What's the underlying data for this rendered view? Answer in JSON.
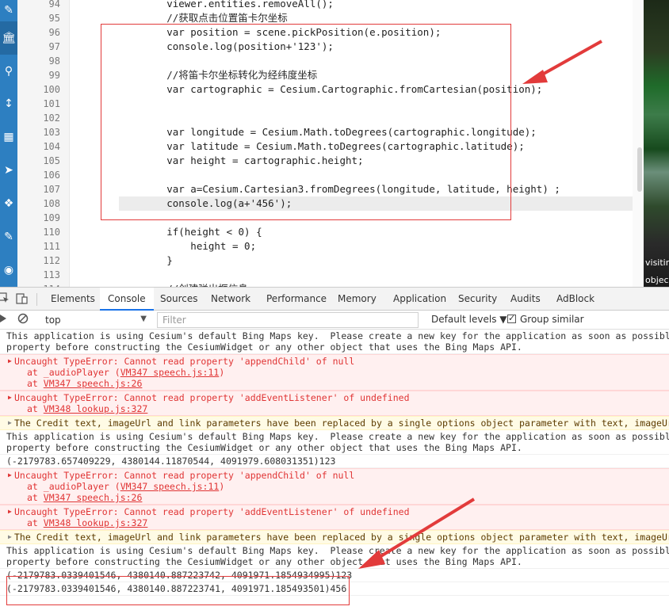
{
  "sidebar": {
    "icons": [
      "pencil-icon",
      "bank-icon",
      "search-icon",
      "arrows-vertical-icon",
      "map-icon",
      "paper-plane-icon",
      "cubes-icon",
      "edit-icon",
      "eye-icon"
    ]
  },
  "editor": {
    "lines": [
      {
        "num": "94",
        "code": "        viewer.entities.removeAll();",
        "type": "code"
      },
      {
        "num": "95",
        "code": "        //获取点击位置笛卡尔坐标",
        "type": "comment"
      },
      {
        "num": "96",
        "code": "        var position = scene.pickPosition(e.position);",
        "type": "code"
      },
      {
        "num": "97",
        "code": "        console.log(position+'123');",
        "type": "code"
      },
      {
        "num": "98",
        "code": "",
        "type": "code"
      },
      {
        "num": "99",
        "code": "        //将笛卡尔坐标转化为经纬度坐标",
        "type": "comment"
      },
      {
        "num": "100",
        "code": "        var cartographic = Cesium.Cartographic.fromCartesian(position);",
        "type": "code"
      },
      {
        "num": "101",
        "code": "",
        "type": "code"
      },
      {
        "num": "102",
        "code": "",
        "type": "code"
      },
      {
        "num": "103",
        "code": "        var longitude = Cesium.Math.toDegrees(cartographic.longitude);",
        "type": "code"
      },
      {
        "num": "104",
        "code": "        var latitude = Cesium.Math.toDegrees(cartographic.latitude);",
        "type": "code"
      },
      {
        "num": "105",
        "code": "        var height = cartographic.height;",
        "type": "code"
      },
      {
        "num": "106",
        "code": "",
        "type": "code"
      },
      {
        "num": "107",
        "code": "        var a=Cesium.Cartesian3.fromDegrees(longitude, latitude, height) ;",
        "type": "code"
      },
      {
        "num": "108",
        "code": "        console.log(a+'456');",
        "type": "cursor"
      },
      {
        "num": "109",
        "code": "",
        "type": "code"
      },
      {
        "num": "110",
        "code": "        if(height < 0) {",
        "type": "code"
      },
      {
        "num": "111",
        "code": "            height = 0;",
        "type": "code"
      },
      {
        "num": "112",
        "code": "        }",
        "type": "code"
      },
      {
        "num": "113",
        "code": "",
        "type": "code"
      },
      {
        "num": "114",
        "code": "        //创建弹出框信息",
        "type": "comment"
      }
    ]
  },
  "preview": {
    "text_1": "visitin",
    "text_2": "objec"
  },
  "devtools": {
    "tabs": [
      "Elements",
      "Console",
      "Sources",
      "Network",
      "Performance",
      "Memory",
      "Application",
      "Security",
      "Audits",
      "AdBlock"
    ],
    "active_tab": "Console"
  },
  "console_toolbar": {
    "context": "top",
    "filter_placeholder": "Filter",
    "levels": "Default levels ▼",
    "group_similar": "Group similar"
  },
  "console_messages": [
    {
      "type": "log",
      "lines": [
        "This application is using Cesium's default Bing Maps key.  Please create a new key for the application as soon as possible and",
        "property before constructing the CesiumWidget or any other object that uses the Bing Maps API."
      ]
    },
    {
      "type": "error",
      "head": "Uncaught TypeError: Cannot read property 'appendChild' of null",
      "stack": [
        [
          "at _audioPlayer (",
          "VM347 speech.js:11",
          ")"
        ],
        [
          "at ",
          "VM347 speech.js:26",
          ""
        ]
      ]
    },
    {
      "type": "error",
      "head": "Uncaught TypeError: Cannot read property 'addEventListener' of undefined",
      "stack": [
        [
          "at ",
          "VM348 lookup.js:327",
          ""
        ]
      ]
    },
    {
      "type": "warn",
      "head": "The Credit text, imageUrl and link parameters have been replaced by a single options object parameter with text, imageUrl and"
    },
    {
      "type": "log",
      "lines": [
        "This application is using Cesium's default Bing Maps key.  Please create a new key for the application as soon as possible and",
        "property before constructing the CesiumWidget or any other object that uses the Bing Maps API."
      ]
    },
    {
      "type": "log",
      "lines": [
        "(-2179783.657409229, 4380144.11870544, 4091979.608031351)123"
      ]
    },
    {
      "type": "error",
      "head": "Uncaught TypeError: Cannot read property 'appendChild' of null",
      "stack": [
        [
          "at _audioPlayer (",
          "VM347 speech.js:11",
          ")"
        ],
        [
          "at ",
          "VM347 speech.js:26",
          ""
        ]
      ]
    },
    {
      "type": "error",
      "head": "Uncaught TypeError: Cannot read property 'addEventListener' of undefined",
      "stack": [
        [
          "at ",
          "VM348 lookup.js:327",
          ""
        ]
      ]
    },
    {
      "type": "warn",
      "head": "The Credit text, imageUrl and link parameters have been replaced by a single options object parameter with text, imageUrl and"
    },
    {
      "type": "log",
      "lines": [
        "This application is using Cesium's default Bing Maps key.  Please create a new key for the application as soon as possible and",
        "property before constructing the CesiumWidget or any other object that uses the Bing Maps API."
      ]
    },
    {
      "type": "log",
      "lines": [
        "(-2179783.0339401546, 4380140.887223742, 4091971.1854934995)123"
      ]
    },
    {
      "type": "log",
      "lines": [
        "(-2179783.0339401546, 4380140.887223741, 4091971.185493501)456"
      ]
    }
  ],
  "colors": {
    "sidebar": "#2d7fc1",
    "highlight": "#e23b3b",
    "error_text": "#e03434",
    "error_bg": "#fff0f0",
    "warn_bg": "#fffbe5"
  }
}
